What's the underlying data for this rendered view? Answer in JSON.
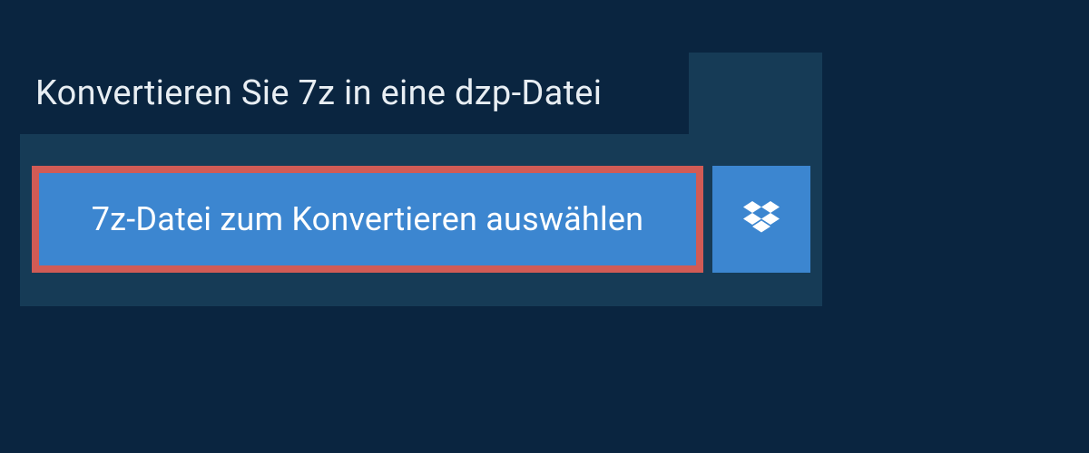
{
  "title": "Konvertieren Sie 7z in eine dzp-Datei",
  "select_button_label": "7z-Datei zum Konvertieren auswählen",
  "icons": {
    "dropbox": "dropbox-icon"
  },
  "colors": {
    "background": "#0a2540",
    "panel": "#163b56",
    "button": "#3c86d0",
    "highlight_border": "#d15b55",
    "text_light": "#e8eef3",
    "text_white": "#ffffff"
  }
}
